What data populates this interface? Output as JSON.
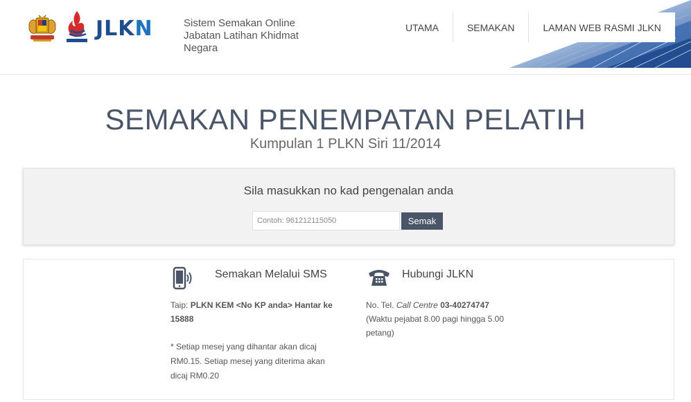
{
  "header": {
    "logo_text_a": "JLK",
    "logo_text_b": "N",
    "site_title": "Sistem Semakan Online Jabatan Latihan Khidmat Negara",
    "nav": [
      {
        "label": "UTAMA"
      },
      {
        "label": "SEMAKAN"
      },
      {
        "label": "LAMAN WEB RASMI JLKN"
      }
    ]
  },
  "main": {
    "title": "SEMAKAN PENEMPATAN PELATIH",
    "subtitle": "Kumpulan 1 PLKN Siri 11/2014"
  },
  "search": {
    "prompt": "Sila masukkan no kad pengenalan anda",
    "placeholder": "Contoh: 961212115050",
    "button_label": "Semak"
  },
  "info": {
    "sms": {
      "icon": "mobile-phone-icon",
      "heading": "Semakan Melalui SMS",
      "text_prefix": "Taip: ",
      "text_bold": "PLKN KEM <No KP anda> Hantar ke 15888",
      "note": "* Setiap mesej yang dihantar akan dicaj RM0.15. Setiap mesej yang diterima akan dicaj RM0.20"
    },
    "contact": {
      "icon": "telephone-icon",
      "heading": "Hubungi JLKN",
      "tel_prefix": "No. Tel. ",
      "tel_italic": "Call Centre",
      "tel_number": "03-40274747",
      "hours": "(Waktu pejabat 8.00 pagi hingga 5.00 petang)"
    }
  },
  "colors": {
    "accent": "#4a5568",
    "logo_blue": "#1f4e8e"
  }
}
